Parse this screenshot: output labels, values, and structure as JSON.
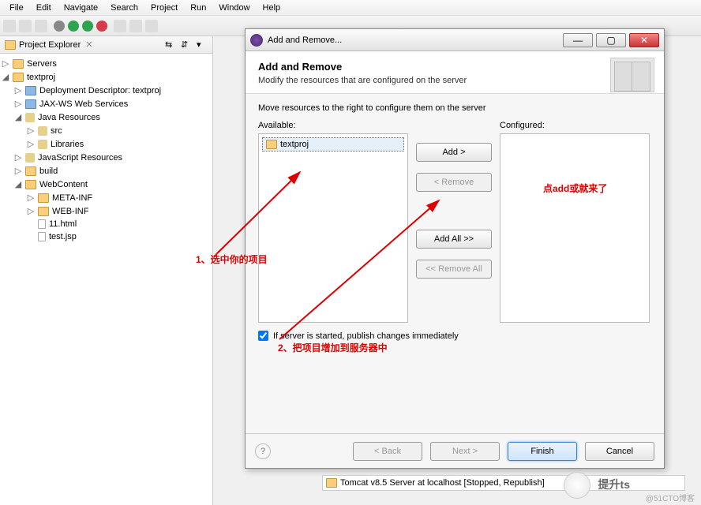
{
  "menu": {
    "items": [
      "File",
      "Edit",
      "Navigate",
      "Search",
      "Project",
      "Run",
      "Window",
      "Help"
    ]
  },
  "explorer": {
    "title": "Project Explorer",
    "tree": [
      {
        "level": 1,
        "expand": "▷",
        "icon": "folder",
        "label": "Servers"
      },
      {
        "level": 1,
        "expand": "◢",
        "icon": "folder",
        "label": "textproj"
      },
      {
        "level": 2,
        "expand": "▷",
        "icon": "blue",
        "label": "Deployment Descriptor: textproj"
      },
      {
        "level": 2,
        "expand": "▷",
        "icon": "blue",
        "label": "JAX-WS Web Services"
      },
      {
        "level": 2,
        "expand": "◢",
        "icon": "pkg",
        "label": "Java Resources"
      },
      {
        "level": 3,
        "expand": "▷",
        "icon": "pkg",
        "label": "src"
      },
      {
        "level": 3,
        "expand": "▷",
        "icon": "pkg",
        "label": "Libraries"
      },
      {
        "level": 2,
        "expand": "▷",
        "icon": "pkg",
        "label": "JavaScript Resources"
      },
      {
        "level": 2,
        "expand": "▷",
        "icon": "folder",
        "label": "build"
      },
      {
        "level": 2,
        "expand": "◢",
        "icon": "folder",
        "label": "WebContent"
      },
      {
        "level": 3,
        "expand": "▷",
        "icon": "folder",
        "label": "META-INF"
      },
      {
        "level": 3,
        "expand": "▷",
        "icon": "folder",
        "label": "WEB-INF"
      },
      {
        "level": 3,
        "expand": "",
        "icon": "file",
        "label": "11.html"
      },
      {
        "level": 3,
        "expand": "",
        "icon": "file",
        "label": "test.jsp"
      }
    ]
  },
  "dialog": {
    "title": "Add and Remove...",
    "heading": "Add and Remove",
    "subheading": "Modify the resources that are configured on the server",
    "instruction": "Move resources to the right to configure them on the server",
    "available_label": "Available:",
    "configured_label": "Configured:",
    "available_items": [
      {
        "label": "textproj",
        "selected": true
      }
    ],
    "buttons": {
      "add": "Add >",
      "remove": "< Remove",
      "add_all": "Add All >>",
      "remove_all": "<< Remove All"
    },
    "checkbox_label": "If server is started, publish changes immediately",
    "checkbox_checked": true,
    "nav": {
      "back": "< Back",
      "next": "Next >",
      "finish": "Finish",
      "cancel": "Cancel"
    }
  },
  "server_status": {
    "label": "Tomcat v8.5 Server at localhost  [Stopped, Republish]"
  },
  "annotations": {
    "step1": "1、选中你的项目",
    "step2": "2、把项目增加到服务器中",
    "hint_add": "点add或就来了"
  },
  "watermark": "@51CTO博客",
  "wx": "提升ts"
}
